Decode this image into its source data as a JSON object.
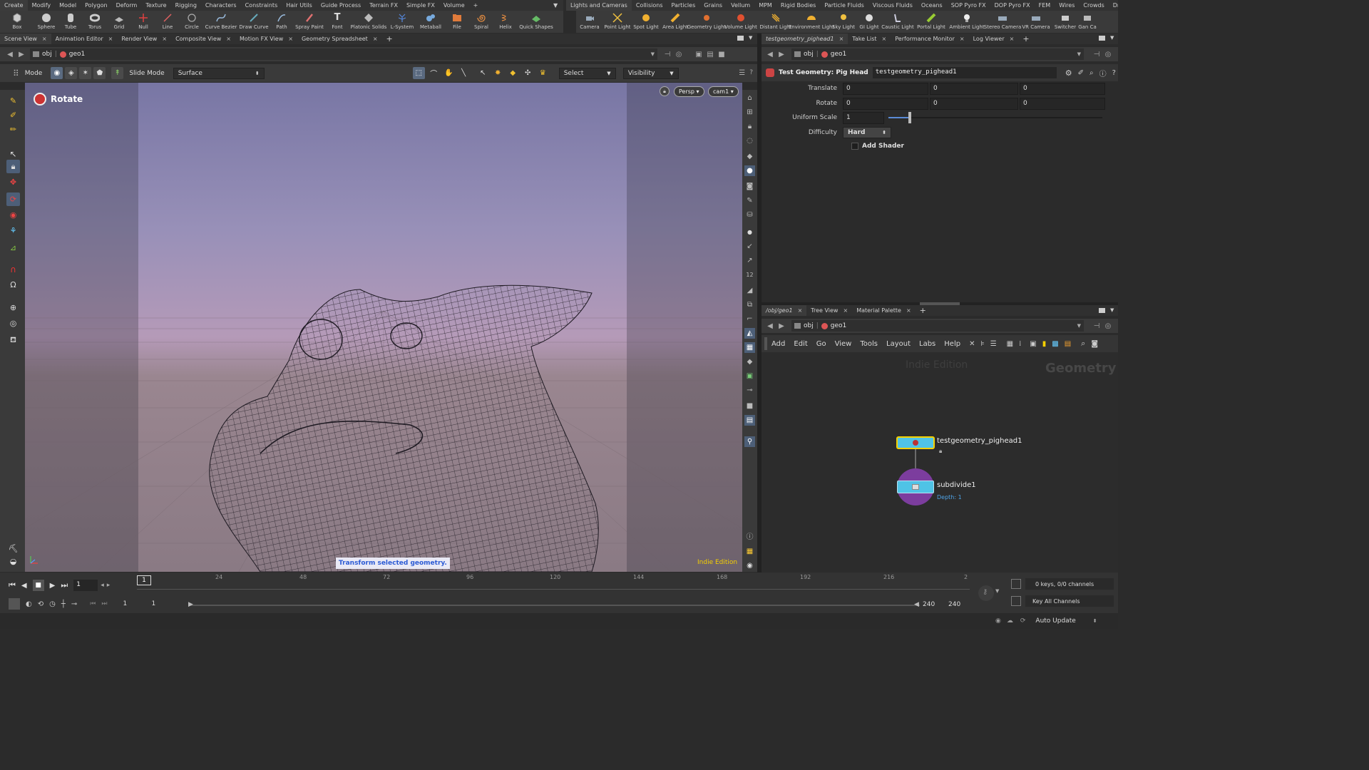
{
  "shelf_left": {
    "tabs": [
      "Create",
      "Modify",
      "Model",
      "Polygon",
      "Deform",
      "Texture",
      "Rigging",
      "Characters",
      "Constraints",
      "Hair Utils",
      "Guide Process",
      "Terrain FX",
      "Simple FX",
      "Volume"
    ],
    "tools": [
      "Box",
      "Sphere",
      "Tube",
      "Torus",
      "Grid",
      "Null",
      "Line",
      "Circle",
      "Curve Bezier",
      "Draw Curve",
      "Path",
      "Spray Paint",
      "Font",
      "Platonic Solids",
      "L-System",
      "Metaball",
      "File",
      "Spiral",
      "Helix",
      "Quick Shapes"
    ]
  },
  "shelf_right": {
    "tabs": [
      "Lights and Cameras",
      "Collisions",
      "Particles",
      "Grains",
      "Vellum",
      "MPM",
      "Rigid Bodies",
      "Particle Fluids",
      "Viscous Fluids",
      "Oceans",
      "SOP Pyro FX",
      "DOP Pyro FX",
      "FEM",
      "Wires",
      "Crowds",
      "Drive Simulation"
    ],
    "tools": [
      "Camera",
      "Point Light",
      "Spot Light",
      "Area Light",
      "Geometry Light",
      "Volume Light",
      "Distant Light",
      "Environment Light",
      "Sky Light",
      "GI Light",
      "Caustic Light",
      "Portal Light",
      "Ambient Light",
      "Stereo Camera",
      "VR Camera",
      "Switcher",
      "Gan Ca"
    ]
  },
  "viewport_tabs": [
    "Scene View",
    "Animation Editor",
    "Render View",
    "Composite View",
    "Motion FX View",
    "Geometry Spreadsheet"
  ],
  "path": {
    "root": "obj",
    "node": "geo1"
  },
  "viewport_toolbar": {
    "mode_label": "Mode",
    "slide_mode": "Slide Mode",
    "surface": "Surface",
    "select": "Select",
    "visibility": "Visibility"
  },
  "viewport": {
    "tool_name": "Rotate",
    "persp": "Persp",
    "cam": "cam1",
    "status": "Transform selected geometry.",
    "edition": "Indie Edition"
  },
  "param_tabs": [
    "testgeometry_pighead1",
    "Take List",
    "Performance Monitor",
    "Log Viewer"
  ],
  "params": {
    "node_type": "Test Geometry: Pig Head",
    "node_name": "testgeometry_pighead1",
    "translate_label": "Translate",
    "translate": [
      "0",
      "0",
      "0"
    ],
    "rotate_label": "Rotate",
    "rotate": [
      "0",
      "0",
      "0"
    ],
    "scale_label": "Uniform Scale",
    "scale": "1",
    "difficulty_label": "Difficulty",
    "difficulty": "Hard",
    "shader_label": "Add Shader"
  },
  "network_tabs": [
    "/obj/geo1",
    "Tree View",
    "Material Palette"
  ],
  "network_menu": [
    "Add",
    "Edit",
    "Go",
    "View",
    "Tools",
    "Layout",
    "Labs",
    "Help"
  ],
  "network": {
    "watermark": "Indie Edition",
    "context": "Geometry",
    "node1": "testgeometry_pighead1",
    "node2": "subdivide1",
    "node2_info": "Depth: 1"
  },
  "timeline": {
    "frame": "1",
    "ticks": [
      "24",
      "48",
      "72",
      "96",
      "120",
      "144",
      "168",
      "192",
      "216",
      "2"
    ],
    "start": "1",
    "start2": "1",
    "end": "240",
    "end2": "240",
    "keys": "0 keys, 0/0 channels",
    "key_all": "Key All Channels",
    "auto_update": "Auto Update"
  },
  "colors": {
    "accent": "#f5d000",
    "node_blue": "#4fc3e6",
    "viewport_top": "#7d7aa6",
    "viewport_bottom": "#b08f9a"
  }
}
